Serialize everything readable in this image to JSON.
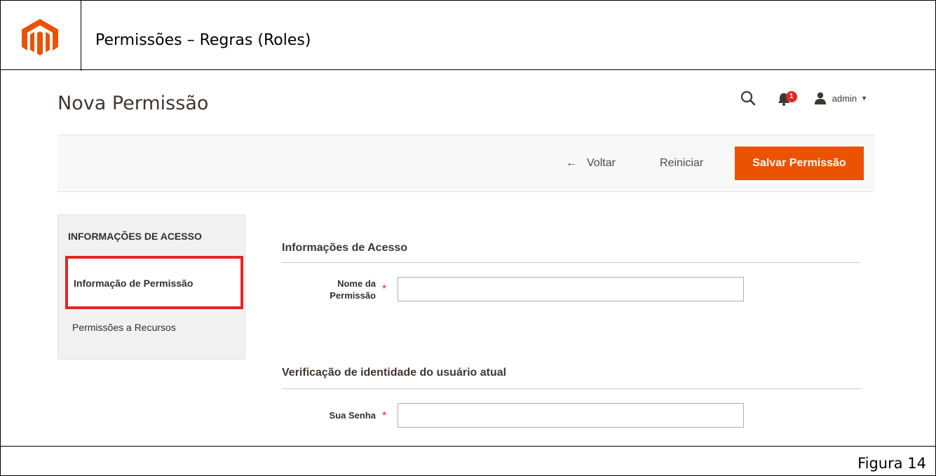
{
  "document": {
    "title": "Permissões – Regras (Roles)",
    "figure_label": "Figura 14",
    "brand_color": "#eb5202"
  },
  "header": {
    "page_title": "Nova Permissão",
    "notification_count": "1",
    "user_name": "admin"
  },
  "toolbar": {
    "back_label": "Voltar",
    "reset_label": "Reiniciar",
    "save_label": "Salvar Permissão"
  },
  "sidebar": {
    "section_title": "INFORMAÇÕES DE ACESSO",
    "items": [
      {
        "label": "Informação de Permissão",
        "active": true
      },
      {
        "label": "Permissões a Recursos",
        "active": false
      }
    ]
  },
  "form": {
    "fieldsets": [
      {
        "title": "Informações de Acesso",
        "fields": [
          {
            "label_line1": "Nome da",
            "label_line2": "Permissão",
            "value": ""
          }
        ]
      },
      {
        "title": "Verificação de identidade do usuário atual",
        "fields": [
          {
            "label": "Sua Senha",
            "value": ""
          }
        ]
      }
    ]
  }
}
